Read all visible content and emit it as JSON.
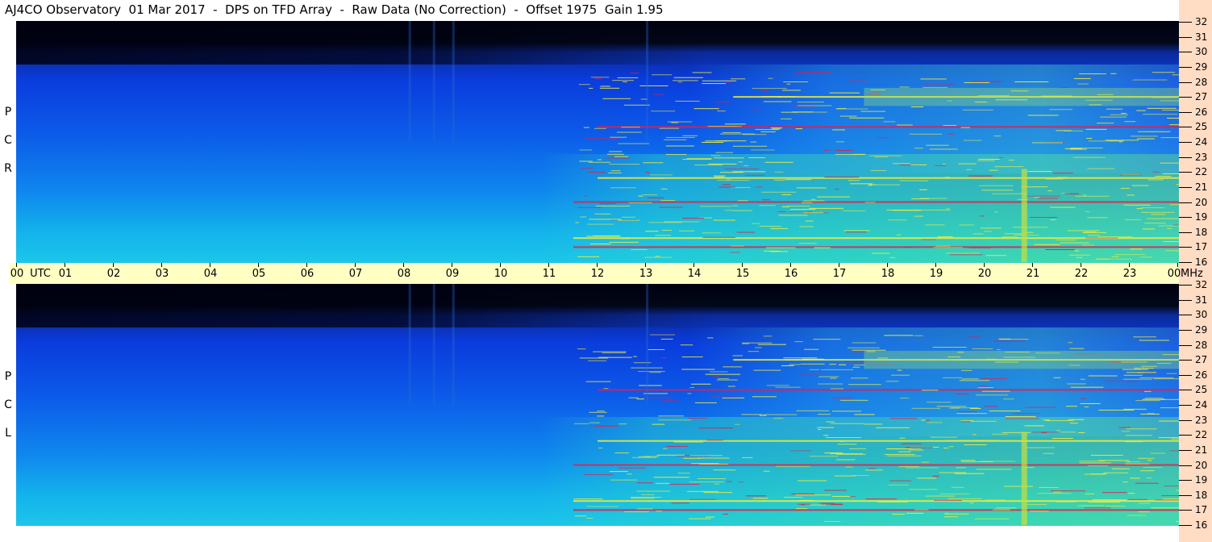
{
  "title": "AJ4CO Observatory  01 Mar 2017  -  DPS on TFD Array  -  Raw Data (No Correction)  -  Offset 1975  Gain 1.95",
  "chart_data": {
    "type": "heatmap",
    "time_axis": {
      "labels": [
        "00",
        "01",
        "02",
        "03",
        "04",
        "05",
        "06",
        "07",
        "08",
        "09",
        "10",
        "11",
        "12",
        "13",
        "14",
        "15",
        "16",
        "17",
        "18",
        "19",
        "20",
        "21",
        "22",
        "23",
        "00"
      ],
      "unit_label": "UTC",
      "range_hours": [
        0,
        24
      ]
    },
    "freq_axis": {
      "labels": [
        "32",
        "31",
        "30",
        "29",
        "28",
        "27",
        "26",
        "25",
        "24",
        "23",
        "22",
        "21",
        "20",
        "19",
        "18",
        "17",
        "16"
      ],
      "unit_label": "MHz",
      "range_mhz": [
        16,
        32
      ]
    },
    "panels": [
      {
        "polarization_letters": [
          "R",
          "C",
          "P"
        ]
      },
      {
        "polarization_letters": [
          "L",
          "C",
          "P"
        ]
      }
    ],
    "interference_lines_mhz": [
      27.0,
      25.0,
      21.6,
      20.0,
      17.6,
      17.0
    ],
    "colors": {
      "background": "#000010",
      "low": "#0a3cdc",
      "mid": "#1fd2dc",
      "high": "#f0ec3c",
      "peak": "#e0204c"
    }
  }
}
